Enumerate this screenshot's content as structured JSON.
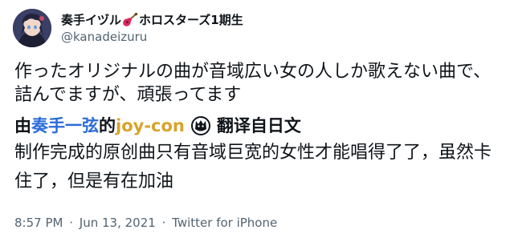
{
  "tweet": {
    "display_name_part1": "奏手イヅル",
    "display_name_part2": "ホロスターズ1期生",
    "handle": "@kanadeizuru",
    "text": "作ったオリジナルの曲が音域広い女の人しか歌えない曲で、詰んでますが、頑張ってます",
    "translation_heading": {
      "part1": "由",
      "part2": "奏手一弦",
      "part3": "的",
      "part4": "joy-con",
      "part5": "翻译自日文"
    },
    "translation_text": "制作完成的原创曲只有音域巨宽的女性才能唱得了了，虽然卡住了，但是有在加油",
    "time": "8:57 PM",
    "date": "Jun 13, 2021",
    "separator": "·",
    "source": "Twitter for iPhone"
  },
  "icons": {
    "avatar": "avatar-image",
    "guitar": "guitar-icon",
    "wolf": "wolf-logo-icon"
  }
}
